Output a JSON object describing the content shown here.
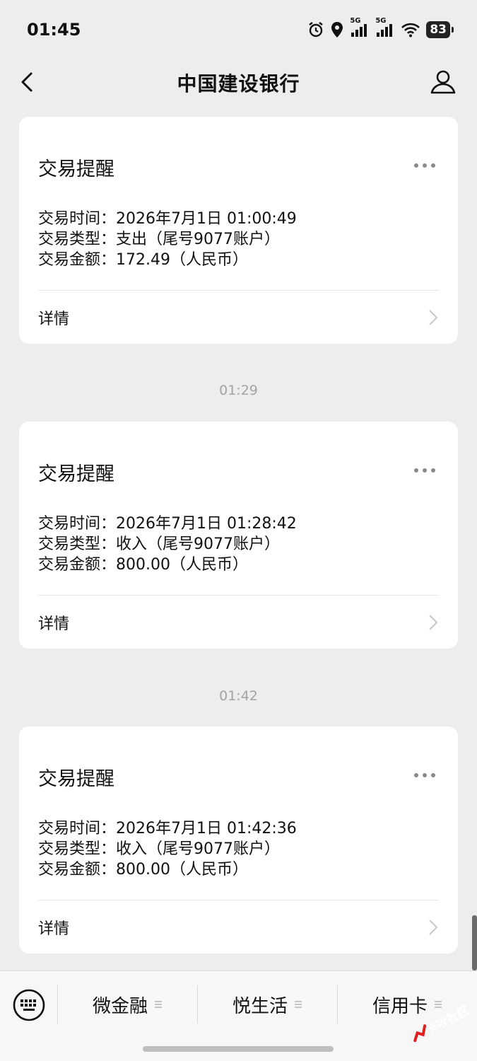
{
  "status_bar": {
    "time": "01:45",
    "network_1": "5G",
    "network_2": "5G",
    "battery": "83",
    "icons": [
      "alarm-icon",
      "location-icon",
      "signal-icon",
      "signal-icon",
      "wifi-icon",
      "battery-icon"
    ]
  },
  "nav": {
    "title": "中国建设银行",
    "back_icon": "chevron-left-icon",
    "profile_icon": "person-icon"
  },
  "messages": [
    {
      "title": "交易提醒",
      "lines": [
        {
          "label": "交易时间：",
          "value": "2026年7月1日 01:00:49"
        },
        {
          "label": "交易类型：",
          "value": "支出（尾号9077账户）"
        },
        {
          "label": "交易金额：",
          "value": "172.49（人民币）"
        }
      ],
      "detail": "详情"
    },
    {
      "timestamp": "01:29",
      "title": "交易提醒",
      "lines": [
        {
          "label": "交易时间：",
          "value": "2026年7月1日 01:28:42"
        },
        {
          "label": "交易类型：",
          "value": "收入（尾号9077账户）"
        },
        {
          "label": "交易金额：",
          "value": "800.00（人民币）"
        }
      ],
      "detail": "详情"
    },
    {
      "timestamp": "01:42",
      "title": "交易提醒",
      "lines": [
        {
          "label": "交易时间：",
          "value": "2026年7月1日 01:42:36"
        },
        {
          "label": "交易类型：",
          "value": "收入（尾号9077账户）"
        },
        {
          "label": "交易金额：",
          "value": "800.00（人民币）"
        }
      ],
      "detail": "详情"
    }
  ],
  "bottom_menu": {
    "keyboard_icon": "keyboard-icon",
    "items": [
      {
        "label": "微金融"
      },
      {
        "label": "悦生活"
      },
      {
        "label": "信用卡"
      }
    ]
  },
  "watermark": {
    "text": "卡农社区"
  },
  "colors": {
    "background": "#ededed",
    "card": "#ffffff",
    "timestamp": "#a3a3a3",
    "text": "#111111"
  }
}
